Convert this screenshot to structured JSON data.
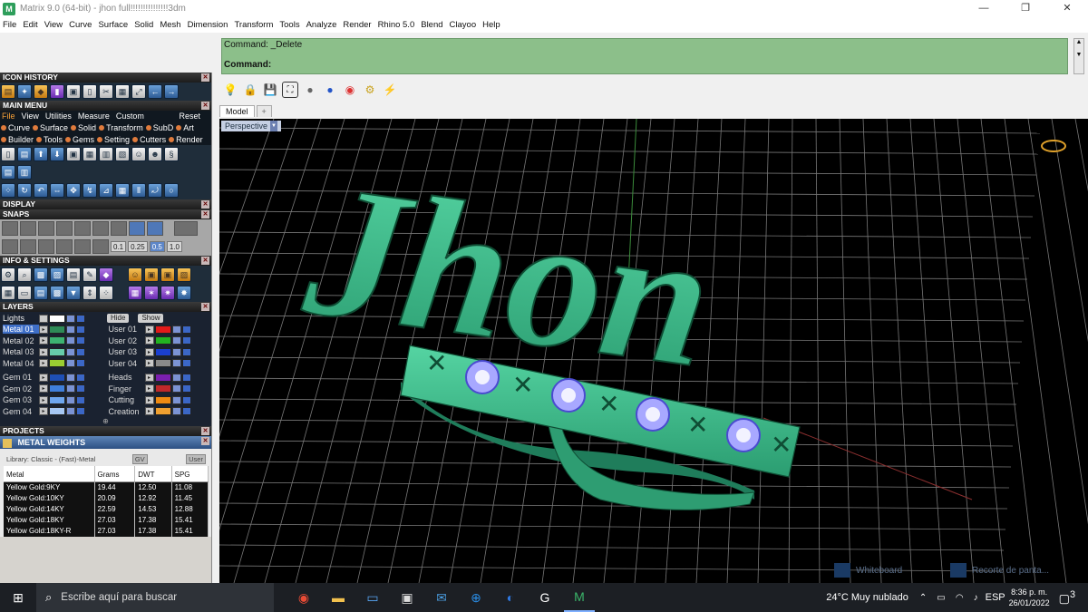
{
  "window": {
    "title": "Matrix 9.0 (64-bit) - jhon full!!!!!!!!!!!!!!!3dm",
    "app_icon": "M",
    "controls": [
      "—",
      "❐",
      "✕"
    ]
  },
  "menubar": [
    "File",
    "Edit",
    "View",
    "Curve",
    "Surface",
    "Solid",
    "Mesh",
    "Dimension",
    "Transform",
    "Tools",
    "Analyze",
    "Render",
    "Rhino 5.0",
    "Blend",
    "Clayoo",
    "Help"
  ],
  "panels": {
    "icon_history": "ICON HISTORY",
    "main_menu": "MAIN MENU",
    "display": "DISPLAY",
    "snaps": "SNAPS",
    "info_settings": "INFO & SETTINGS",
    "layers": "LAYERS",
    "projects": "PROJECTS",
    "metal_weights": "METAL WEIGHTS"
  },
  "main_menu": {
    "tabs": [
      "File",
      "View",
      "Utilities",
      "Measure",
      "Custom"
    ],
    "reset": "Reset",
    "row1": [
      "Curve",
      "Surface",
      "Solid",
      "Transform",
      "SubD",
      "Art"
    ],
    "row2": [
      "Builder",
      "Tools",
      "Gems",
      "Setting",
      "Cutters",
      "Render"
    ]
  },
  "snaps": {
    "values": [
      "0.1",
      "0.25",
      "0.5",
      "1.0"
    ]
  },
  "layers": {
    "lights": "Lights",
    "hide": "Hide",
    "show": "Show",
    "left": [
      {
        "name": "Metal 01",
        "color": "#2e8b57",
        "selected": true
      },
      {
        "name": "Metal 02",
        "color": "#3cb371",
        "selected": false
      },
      {
        "name": "Metal 03",
        "color": "#66cdaa",
        "selected": false
      },
      {
        "name": "Metal 04",
        "color": "#9acd32",
        "selected": false
      },
      {
        "name": "Gem 01",
        "color": "#1e4fb5",
        "selected": false
      },
      {
        "name": "Gem 02",
        "color": "#3f7fdc",
        "selected": false
      },
      {
        "name": "Gem 03",
        "color": "#6ea6ee",
        "selected": false
      },
      {
        "name": "Gem 04",
        "color": "#a7c8f3",
        "selected": false
      }
    ],
    "right": [
      {
        "name": "User 01",
        "color": "#e21a1a"
      },
      {
        "name": "User 02",
        "color": "#22b322"
      },
      {
        "name": "User 03",
        "color": "#1b3fd0"
      },
      {
        "name": "User 04",
        "color": "#8a8a8a"
      },
      {
        "name": "Heads",
        "color": "#7a1fb0"
      },
      {
        "name": "Finger",
        "color": "#c0282a"
      },
      {
        "name": "Cutting",
        "color": "#ef8a12"
      },
      {
        "name": "Creation",
        "color": "#f0a030"
      }
    ]
  },
  "metal_weights": {
    "library": "Library: Classic - (Fast)-Metal",
    "gv": "GV",
    "user": "User",
    "columns": [
      "Metal",
      "Grams",
      "DWT",
      "SPG"
    ],
    "rows": [
      [
        "Yellow Gold:9KY",
        "19.44",
        "12.50",
        "11.08"
      ],
      [
        "Yellow Gold:10KY",
        "20.09",
        "12.92",
        "11.45"
      ],
      [
        "Yellow Gold:14KY",
        "22.59",
        "14.53",
        "12.88"
      ],
      [
        "Yellow Gold:18KY",
        "27.03",
        "17.38",
        "15.41"
      ],
      [
        "Yellow Gold:18KY-R",
        "27.03",
        "17.38",
        "15.41"
      ]
    ]
  },
  "command": {
    "line1": "Command: _Delete",
    "line2": "Command:"
  },
  "viewport": {
    "tab_model": "Model",
    "tab_add": "+",
    "label": "Perspective",
    "model_text": "Jhon",
    "notifications": [
      "Whiteboard",
      "Recorte de panta..."
    ],
    "colors": {
      "model": "#3dbb8c",
      "model_dark": "#1f7d5b",
      "grid": "#7a7a7a",
      "gem": "#a8a8ff"
    }
  },
  "taskbar": {
    "search_placeholder": "Escribe aquí para buscar",
    "weather": "24°C  Muy nublado",
    "lang": "ESP",
    "time": "8:36 p. m.",
    "date": "26/01/2022",
    "notify_count": "3"
  }
}
